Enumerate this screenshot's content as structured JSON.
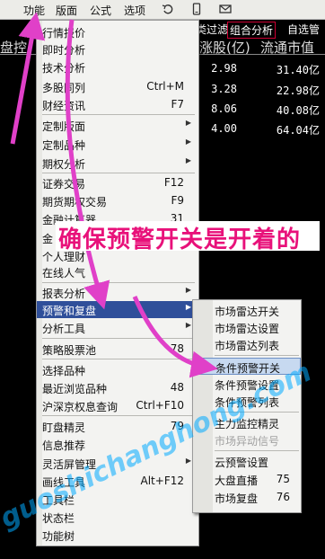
{
  "menubar": {
    "items": [
      "功能",
      "版面",
      "公式",
      "选项"
    ],
    "icons": [
      "refresh-icon",
      "phone-icon",
      "mail-icon"
    ]
  },
  "table": {
    "tabs": [
      "类过滤",
      "组合分析",
      "自选管"
    ],
    "columns": [
      "盘控",
      "涨股(亿)",
      "流通市值"
    ],
    "rows": [
      {
        "a": "2.98",
        "b": "31.40亿"
      },
      {
        "a": "3.28",
        "b": "22.98亿"
      },
      {
        "a": "8.06",
        "b": "40.08亿"
      },
      {
        "a": "4.00",
        "b": "64.04亿"
      }
    ]
  },
  "main_menu": {
    "items": [
      {
        "label": "行情报价",
        "shortcut": ""
      },
      {
        "label": "即时分析",
        "shortcut": ""
      },
      {
        "label": "技术分析",
        "shortcut": ""
      },
      {
        "label": "多股同列",
        "shortcut": "Ctrl+M"
      },
      {
        "label": "财经资讯",
        "shortcut": "F7"
      },
      {
        "label": "定制版面",
        "shortcut": ""
      },
      {
        "label": "定制品种",
        "shortcut": ""
      },
      {
        "label": "期权分析",
        "shortcut": ""
      },
      {
        "label": "证券交易",
        "shortcut": "F12"
      },
      {
        "label": "期货期权交易",
        "shortcut": "F9"
      },
      {
        "label": "金融计算器",
        "shortcut": "31"
      },
      {
        "label": "金",
        "shortcut": ""
      },
      {
        "label": "个人理财",
        "shortcut": ""
      },
      {
        "label": "在线人气",
        "shortcut": ""
      },
      {
        "label": "报表分析",
        "shortcut": ""
      },
      {
        "label": "预警和复盘",
        "shortcut": ""
      },
      {
        "label": "分析工具",
        "shortcut": ""
      },
      {
        "label": "策略股票池",
        "shortcut": "78"
      },
      {
        "label": "选择品种",
        "shortcut": ""
      },
      {
        "label": "最近浏览品种",
        "shortcut": "48"
      },
      {
        "label": "沪深京权息查询",
        "shortcut": "Ctrl+F10"
      },
      {
        "label": "盯盘精灵",
        "shortcut": "79"
      },
      {
        "label": "信息推荐",
        "shortcut": ""
      },
      {
        "label": "灵活屏管理",
        "shortcut": ""
      },
      {
        "label": "画线工具",
        "shortcut": "Alt+F12"
      },
      {
        "label": "工具栏",
        "shortcut": ""
      },
      {
        "label": "状态栏",
        "shortcut": ""
      },
      {
        "label": "功能树",
        "shortcut": ""
      }
    ]
  },
  "sub_menu": {
    "items": [
      {
        "label": "市场雷达开关",
        "shortcut": ""
      },
      {
        "label": "市场雷达设置",
        "shortcut": ""
      },
      {
        "label": "市场雷达列表",
        "shortcut": ""
      },
      {
        "label": "条件预警开关",
        "shortcut": ""
      },
      {
        "label": "条件预警设置",
        "shortcut": ""
      },
      {
        "label": "条件预警列表",
        "shortcut": ""
      },
      {
        "label": "主力监控精灵",
        "shortcut": ""
      },
      {
        "label": "市场异动信号",
        "shortcut": ""
      },
      {
        "label": "云预警设置",
        "shortcut": ""
      },
      {
        "label": "大盘直播",
        "shortcut": "75"
      },
      {
        "label": "市场复盘",
        "shortcut": "76"
      }
    ],
    "checked": "✔"
  },
  "annotation": {
    "text": "确保预警开关是开着的",
    "color": "#e8117a"
  },
  "watermark": "guoshichanghong.com",
  "colors": {
    "highlight": "#2f4f9a",
    "sub_highlight": "#c7d9f0",
    "arrow": "#e040c8"
  }
}
